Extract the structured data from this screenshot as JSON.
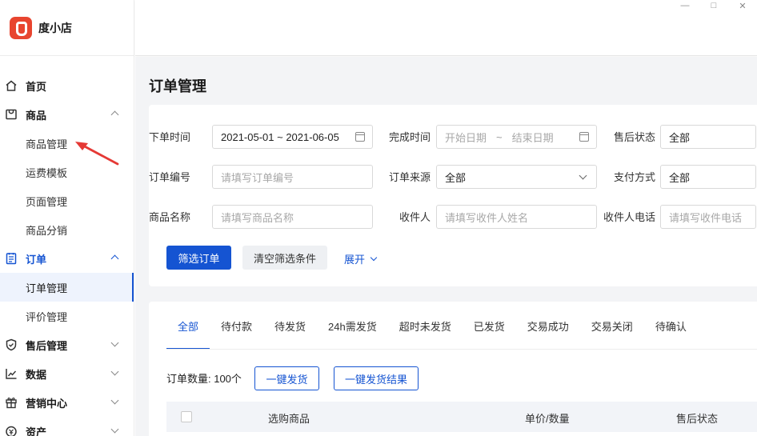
{
  "app": {
    "name": "度小店"
  },
  "window": {
    "minimize": "—",
    "maximize": "□",
    "close": "✕"
  },
  "sidebar": {
    "items": [
      {
        "label": "首页",
        "icon": "home-icon"
      },
      {
        "label": "商品",
        "icon": "shop-bag-icon",
        "children": [
          "商品管理",
          "运费模板",
          "页面管理",
          "商品分销"
        ]
      },
      {
        "label": "订单",
        "icon": "order-list-icon",
        "children": [
          "订单管理",
          "评价管理"
        ]
      },
      {
        "label": "售后管理",
        "icon": "shield-check-icon"
      },
      {
        "label": "数据",
        "icon": "chart-line-icon"
      },
      {
        "label": "营销中心",
        "icon": "gift-icon"
      },
      {
        "label": "资产",
        "icon": "asset-icon"
      }
    ]
  },
  "page": {
    "title": "订单管理"
  },
  "filters": {
    "order_time": {
      "label": "下单时间",
      "value": "2021-05-01 ~ 2021-06-05"
    },
    "finish_time": {
      "label": "完成时间",
      "start_placeholder": "开始日期",
      "sep": "~",
      "end_placeholder": "结束日期"
    },
    "after_sale_status": {
      "label": "售后状态",
      "value": "全部"
    },
    "order_no": {
      "label": "订单编号",
      "placeholder": "请填写订单编号"
    },
    "order_source": {
      "label": "订单来源",
      "value": "全部"
    },
    "pay_method": {
      "label": "支付方式",
      "value": "全部"
    },
    "product_name": {
      "label": "商品名称",
      "placeholder": "请填写商品名称"
    },
    "receiver": {
      "label": "收件人",
      "placeholder": "请填写收件人姓名"
    },
    "receiver_phone": {
      "label": "收件人电话",
      "placeholder": "请填写收件电话"
    },
    "filter_button": "筛选订单",
    "clear_button": "清空筛选条件",
    "expand": "展开"
  },
  "tabs": [
    "全部",
    "待付款",
    "待发货",
    "24h需发货",
    "超时未发货",
    "已发货",
    "交易成功",
    "交易关闭",
    "待确认"
  ],
  "list": {
    "count_label": "订单数量: 100个",
    "ship_button": "一键发货",
    "ship_result_button": "一键发货结果",
    "columns": [
      "选购商品",
      "单价/数量",
      "售后状态"
    ]
  },
  "colors": {
    "accent": "#1554d2",
    "brand": "#e8452f",
    "annotation_arrow": "#e53935"
  }
}
